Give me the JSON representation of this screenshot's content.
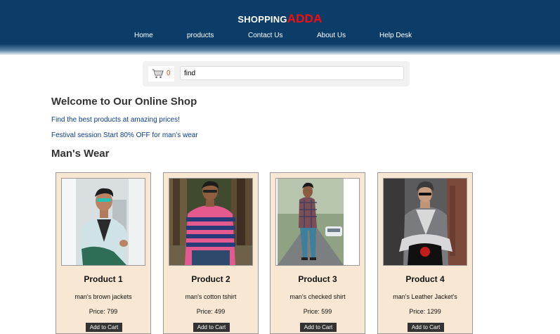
{
  "brand": {
    "prefix": "SHOPPING",
    "accent": "ADDA",
    "accent_color": "#ff0a0a"
  },
  "nav": [
    "Home",
    "products",
    "Contact Us",
    "About Us",
    "Help Desk"
  ],
  "cart": {
    "icon": "shopping-cart-icon",
    "count": "0"
  },
  "search": {
    "value": "find"
  },
  "welcome": {
    "title": "Welcome to Our Online Shop",
    "line1": "Find the best products at amazing prices!",
    "line2": "Festival session Start 80% OFF for man's wear"
  },
  "section_title": "Man's Wear",
  "products": [
    {
      "title": "Product 1",
      "desc": "man's brown jackets",
      "price": "Price: 799",
      "button": "Add to Cart"
    },
    {
      "title": "Product 2",
      "desc": "man's cotton tshirt",
      "price": "Price: 499",
      "button": "Add to Cart"
    },
    {
      "title": "Product 3",
      "desc": "man's checked shirt",
      "price": "Price: 599",
      "button": "Add to Cart"
    },
    {
      "title": "Product 4",
      "desc": "man's Leather Jacket's",
      "price": "Price: 1299",
      "button": "Add to Cart"
    }
  ],
  "colors": {
    "header": "#0b3d68",
    "card": "#f8e7d3",
    "link": "#0b3d8a"
  }
}
